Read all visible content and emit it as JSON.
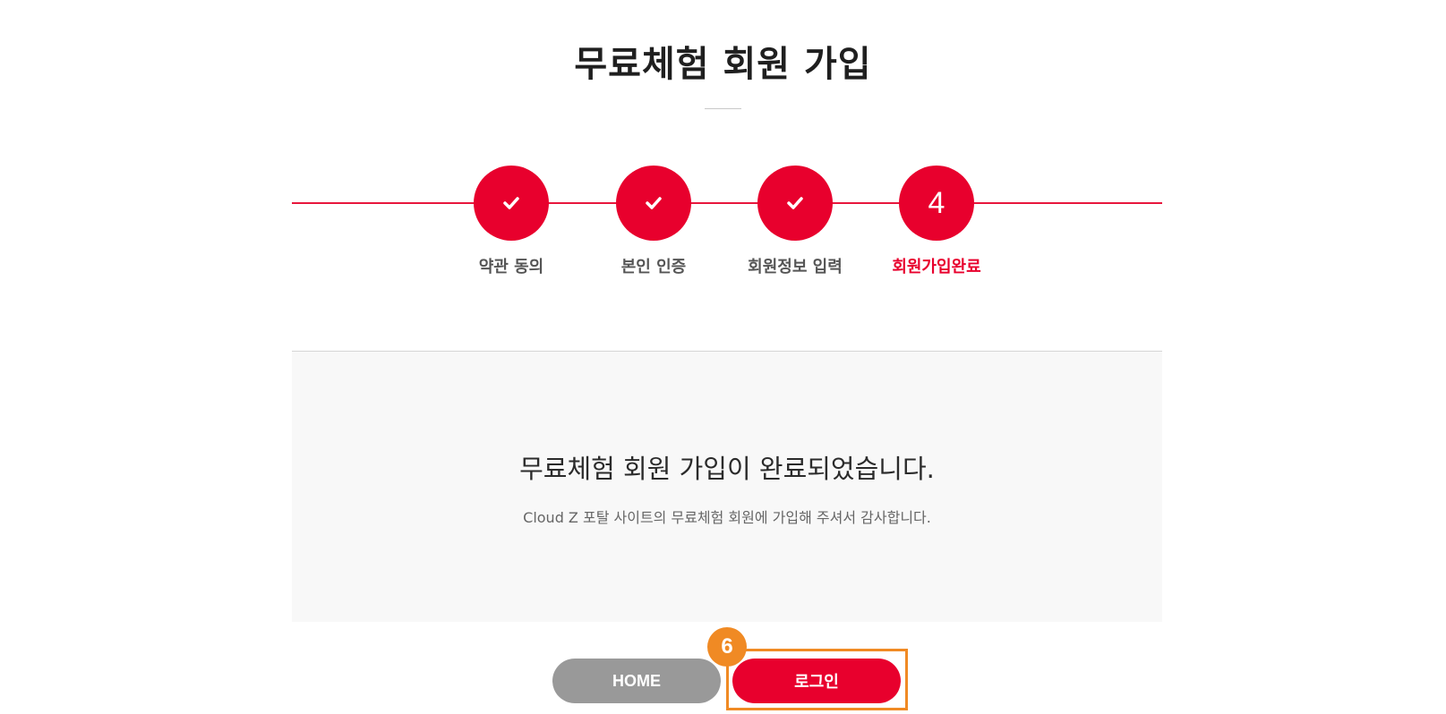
{
  "page": {
    "title": "무료체험 회원 가입"
  },
  "steps": [
    {
      "label": "약관 동의",
      "status": "done",
      "icon": "check-icon"
    },
    {
      "label": "본인 인증",
      "status": "done",
      "icon": "check-icon"
    },
    {
      "label": "회원정보 입력",
      "status": "done",
      "icon": "check-icon"
    },
    {
      "label": "회원가입완료",
      "status": "current",
      "number": "4"
    }
  ],
  "result": {
    "title": "무료체험 회원 가입이 완료되었습니다.",
    "description": "Cloud Z 포탈 사이트의 무료체험 회원에 가입해 주셔서 감사합니다."
  },
  "buttons": {
    "home_label": "HOME",
    "login_label": "로그인"
  },
  "annotation": {
    "badge_number": "6"
  },
  "colors": {
    "accent": "#e8002d",
    "home_button": "#999999",
    "annotation": "#f08a24",
    "content_background": "#f8f8f8"
  }
}
